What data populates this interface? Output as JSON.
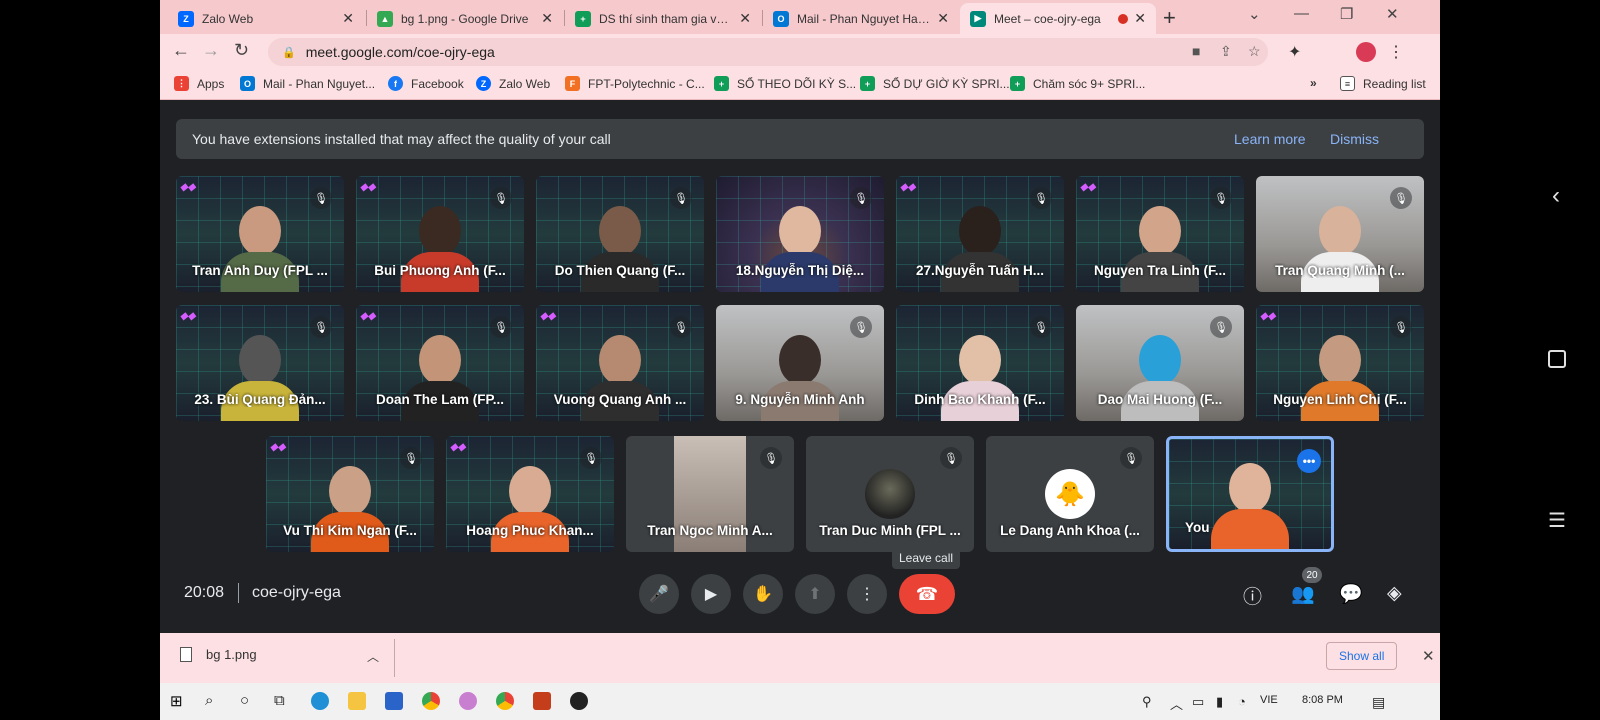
{
  "browser": {
    "tabs": [
      {
        "title": "Zalo Web",
        "color": "#0068ff",
        "glyph": "Z",
        "active": false
      },
      {
        "title": "bg 1.png - Google Drive",
        "color": "#34a853",
        "glyph": "▲",
        "active": false
      },
      {
        "title": "DS thí sinh tham gia vòng",
        "color": "#0f9d58",
        "glyph": "+",
        "active": false
      },
      {
        "title": "Mail - Phan Nguyet Ha (F",
        "color": "#0078d4",
        "glyph": "O",
        "active": false
      },
      {
        "title": "Meet – coe-ojry-ega",
        "color": "#00897b",
        "glyph": "▶",
        "active": true
      }
    ],
    "new_tab": "+",
    "url": "meet.google.com/coe-ojry-ega",
    "bookmarks": [
      {
        "label": "Apps",
        "color": "#ea4335",
        "glyph": "⋮"
      },
      {
        "label": "Mail - Phan Nguyet...",
        "color": "#0078d4",
        "glyph": "O"
      },
      {
        "label": "Facebook",
        "color": "#1877f2",
        "glyph": "f"
      },
      {
        "label": "Zalo Web",
        "color": "#0068ff",
        "glyph": "Z"
      },
      {
        "label": "FPT-Polytechnic - C...",
        "color": "#f27024",
        "glyph": "F"
      },
      {
        "label": "SỔ THEO DÕI KỲ S...",
        "color": "#0f9d58",
        "glyph": "+"
      },
      {
        "label": "SỔ DỰ GIỜ KỲ SPRI...",
        "color": "#0f9d58",
        "glyph": "+"
      },
      {
        "label": "Chăm sóc 9+ SPRI...",
        "color": "#0f9d58",
        "glyph": "+"
      }
    ],
    "more_bookmarks": "»",
    "reading_list": "Reading list"
  },
  "banner": {
    "text": "You have extensions installed that may affect the quality of your call",
    "learn_more": "Learn more",
    "dismiss": "Dismiss"
  },
  "participants_row1": [
    {
      "name": "Tran Anh Duy (FPL ..."
    },
    {
      "name": "Bui Phuong Anh (F..."
    },
    {
      "name": "Do Thien Quang (F..."
    },
    {
      "name": "18.Nguyễn Thị Diệ..."
    },
    {
      "name": "27.Nguyễn Tuấn H..."
    },
    {
      "name": "Nguyen Tra Linh (F..."
    },
    {
      "name": "Tran Quang Minh (..."
    }
  ],
  "participants_row2": [
    {
      "name": "23. Bùi Quang Đản..."
    },
    {
      "name": "Doan The Lam (FP..."
    },
    {
      "name": "Vuong Quang Anh ..."
    },
    {
      "name": "9. Nguyễn Minh Anh"
    },
    {
      "name": "Dinh Bao Khanh (F..."
    },
    {
      "name": "Dao Mai Huong (F..."
    },
    {
      "name": "Nguyen Linh Chi (F..."
    }
  ],
  "participants_row3": [
    {
      "name": "Vu Thi Kim Ngan (F..."
    },
    {
      "name": "Hoang Phuc Khan..."
    },
    {
      "name": "Tran Ngoc Minh A..."
    },
    {
      "name": "Tran Duc Minh (FPL ..."
    },
    {
      "name": "Le Dang Anh Khoa (..."
    },
    {
      "name": "You"
    }
  ],
  "tooltip": "Leave call",
  "meeting": {
    "time": "20:08",
    "code": "coe-ojry-ega",
    "participant_count": "20"
  },
  "download": {
    "file": "bg 1.png",
    "show_all": "Show all"
  },
  "taskbar": {
    "language": "VIE",
    "time": "8:08 PM"
  }
}
